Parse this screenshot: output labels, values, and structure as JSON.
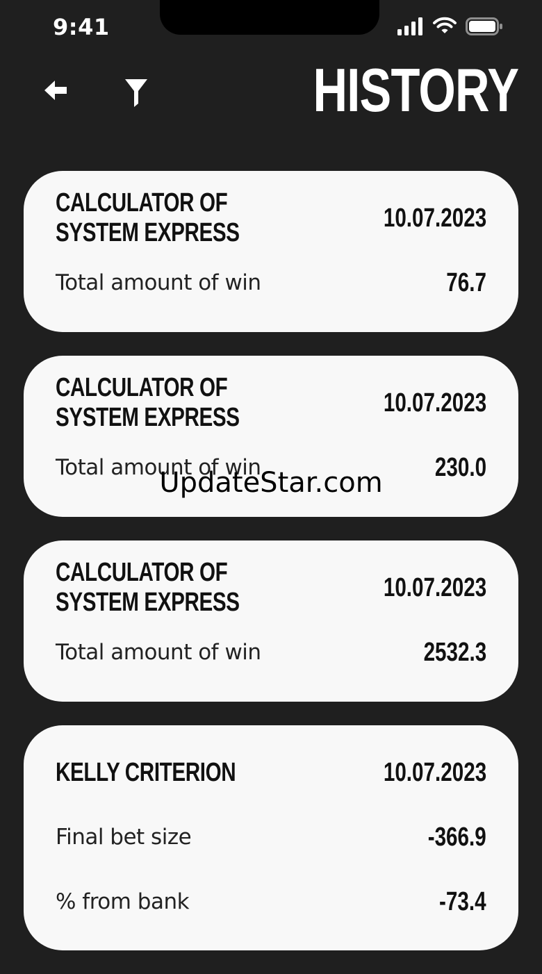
{
  "status_bar": {
    "time": "9:41"
  },
  "header": {
    "title": "HISTORY"
  },
  "cards": [
    {
      "title": "CALCULATOR OF SYSTEM EXPRESS",
      "date": "10.07.2023",
      "rows": [
        {
          "label": "Total amount of win",
          "value": "76.7"
        }
      ]
    },
    {
      "title": "CALCULATOR OF SYSTEM EXPRESS",
      "date": "10.07.2023",
      "rows": [
        {
          "label": "Total amount of win",
          "value": "230.0"
        }
      ]
    },
    {
      "title": "CALCULATOR OF SYSTEM EXPRESS",
      "date": "10.07.2023",
      "rows": [
        {
          "label": "Total amount of win",
          "value": "2532.3"
        }
      ]
    },
    {
      "title": "KELLY CRITERION",
      "date": "10.07.2023",
      "rows": [
        {
          "label": "Final bet size",
          "value": "-366.9"
        },
        {
          "label": "% from bank",
          "value": "-73.4"
        }
      ]
    }
  ],
  "watermark": "UpdateStar.com"
}
